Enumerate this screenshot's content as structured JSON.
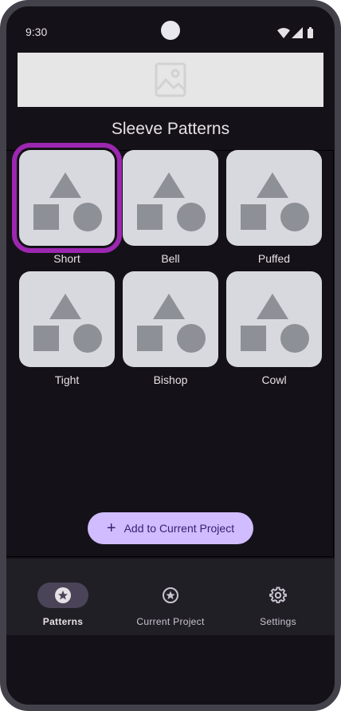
{
  "status_bar": {
    "time": "9:30"
  },
  "page_title": "Sleeve Patterns",
  "patterns": [
    {
      "label": "Short",
      "selected": true
    },
    {
      "label": "Bell",
      "selected": false
    },
    {
      "label": "Puffed",
      "selected": false
    },
    {
      "label": "Tight",
      "selected": false
    },
    {
      "label": "Bishop",
      "selected": false
    },
    {
      "label": "Cowl",
      "selected": false
    }
  ],
  "add_button": {
    "label": "Add to Current Project",
    "icon": "plus-icon"
  },
  "nav": {
    "items": [
      {
        "label": "Patterns",
        "icon": "star-icon",
        "active": true
      },
      {
        "label": "Current Project",
        "icon": "star-outline-icon",
        "active": false
      },
      {
        "label": "Settings",
        "icon": "gear-icon",
        "active": false
      }
    ]
  },
  "colors": {
    "selection_outline": "#9c27b0",
    "button_bg": "#d0bcff",
    "background": "#141218",
    "tile_bg": "#d8d9de"
  }
}
